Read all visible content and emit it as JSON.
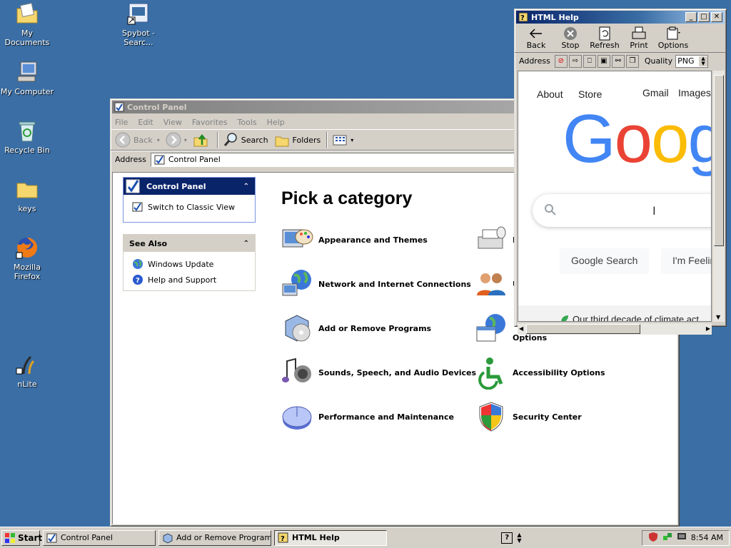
{
  "desktop": {
    "icons": [
      {
        "label": "My Documents"
      },
      {
        "label": "Spybot - Searc..."
      },
      {
        "label": "My Computer"
      },
      {
        "label": "Recycle Bin"
      },
      {
        "label": "keys"
      },
      {
        "label": "Mozilla Firefox"
      },
      {
        "label": "nLite"
      }
    ]
  },
  "control_panel": {
    "title": "Control Panel",
    "menu": [
      "File",
      "Edit",
      "View",
      "Favorites",
      "Tools",
      "Help"
    ],
    "toolbar": {
      "back": "Back",
      "search": "Search",
      "folders": "Folders"
    },
    "address_label": "Address",
    "address_value": "Control Panel",
    "sidebar": {
      "panel_title": "Control Panel",
      "switch_view": "Switch to Classic View",
      "see_also_title": "See Also",
      "see_also_items": [
        "Windows Update",
        "Help and Support"
      ]
    },
    "heading": "Pick a category",
    "categories_left": [
      "Appearance and Themes",
      "Network and Internet Connections",
      "Add or Remove Programs",
      "Sounds, Speech, and Audio Devices",
      "Performance and Maintenance"
    ],
    "categories_right": [
      "P",
      "U",
      "Options",
      "Accessibility Options",
      "Security Center"
    ]
  },
  "html_help": {
    "title": "HTML Help",
    "tools": [
      "Back",
      "Stop",
      "Refresh",
      "Print",
      "Options"
    ],
    "address_label": "Address",
    "quality_label": "Quality",
    "quality_value": "PNG",
    "google": {
      "nav": [
        "About",
        "Store",
        "Gmail",
        "Images"
      ],
      "logo": [
        "G",
        "o",
        "o",
        "g"
      ],
      "logo_colors": [
        "#4285f4",
        "#ea4335",
        "#fbbc05",
        "#4285f4"
      ],
      "search_button": "Google Search",
      "lucky_button": "I'm Feelin",
      "footer_text": "Our third decade of climate act"
    }
  },
  "taskbar": {
    "start": "Start",
    "tasks": [
      "Control Panel",
      "Add or Remove Programs",
      "HTML Help"
    ],
    "clock": "8:54 AM"
  }
}
